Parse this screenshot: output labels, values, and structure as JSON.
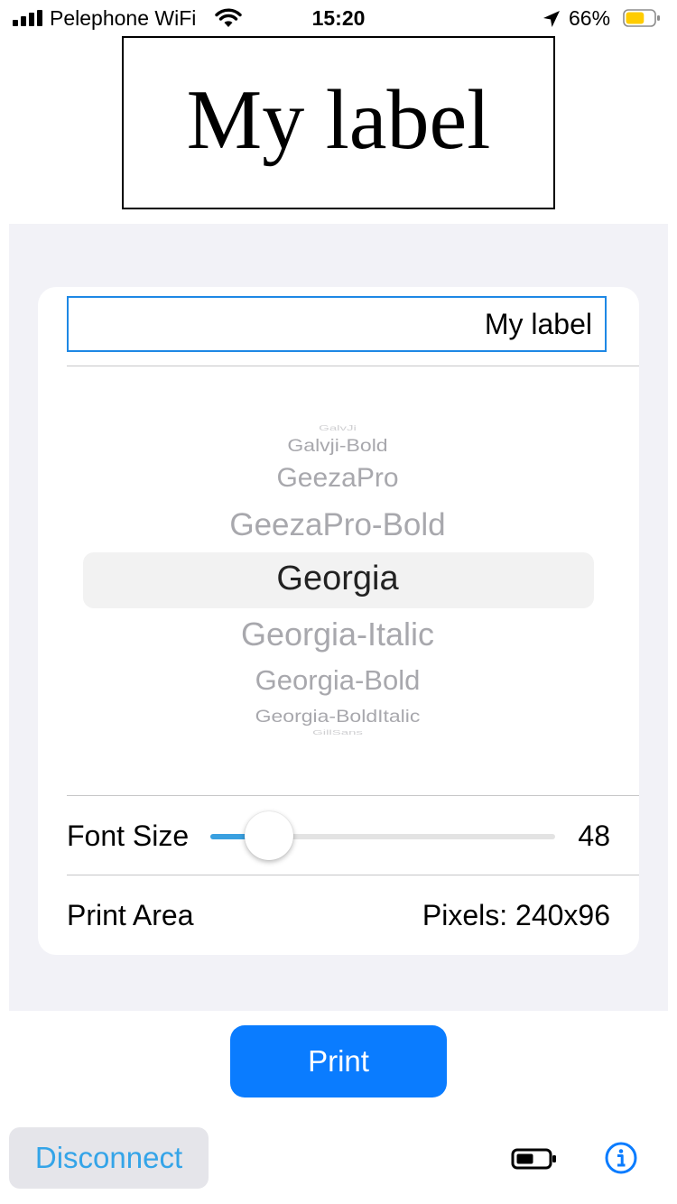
{
  "status_bar": {
    "carrier": "Pelephone WiFi",
    "time": "15:20",
    "battery_percent": "66%",
    "battery_level": 0.66,
    "battery_color": "#ffcc00",
    "icons": [
      "signal-icon",
      "wifi-icon",
      "location-arrow-icon",
      "battery-icon"
    ]
  },
  "preview": {
    "text": "My label"
  },
  "label_input": {
    "value": "My label"
  },
  "font_picker": {
    "items": [
      "GalvJi",
      "Galvji-Bold",
      "GeezaPro",
      "GeezaPro-Bold",
      "Georgia",
      "Georgia-Italic",
      "Georgia-Bold",
      "Georgia-BoldItalic",
      "GillSans"
    ],
    "selected": "Georgia"
  },
  "font_size": {
    "label": "Font Size",
    "value": "48",
    "slider_fraction": 0.17,
    "accent_color": "#3aa0e0"
  },
  "print_area": {
    "label": "Print Area",
    "value": "Pixels: 240x96"
  },
  "buttons": {
    "print": "Print",
    "print_color": "#0a7cff",
    "disconnect": "Disconnect",
    "disconnect_color": "#34a4e8"
  },
  "bottom_icons": [
    "device-battery-icon",
    "info-icon"
  ]
}
